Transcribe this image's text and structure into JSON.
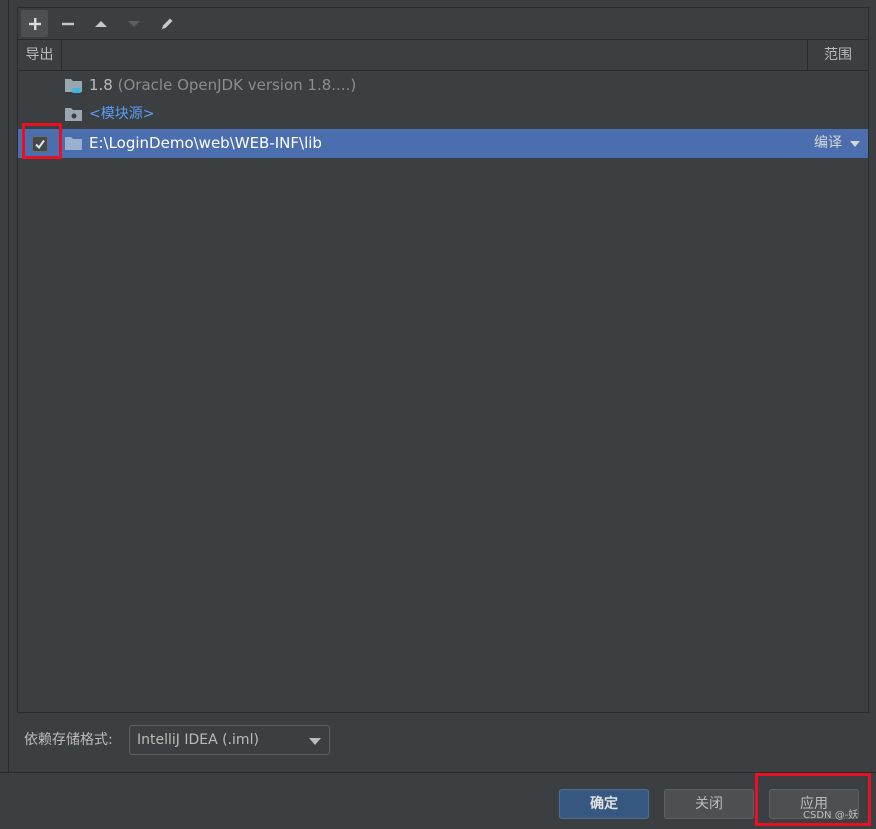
{
  "toolbar": {
    "buttons": [
      {
        "name": "add",
        "icon": "plus-icon",
        "active": true
      },
      {
        "name": "remove",
        "icon": "minus-icon"
      },
      {
        "name": "move-up",
        "icon": "arrow-up-icon"
      },
      {
        "name": "move-down",
        "icon": "arrow-down-icon",
        "disabled": true
      },
      {
        "name": "edit",
        "icon": "pencil-icon"
      }
    ]
  },
  "table": {
    "headers": {
      "export": "导出",
      "scope": "范围"
    },
    "rows": [
      {
        "version": "1.8",
        "detail": "(Oracle OpenJDK version 1.8....)",
        "icon": "jdk-folder-icon"
      },
      {
        "label": "<模块源>",
        "icon": "module-source-folder-icon"
      },
      {
        "path": "E:\\LoginDemo\\web\\WEB-INF\\lib",
        "checked": true,
        "scope": "编译",
        "icon": "folder-icon",
        "selected": true
      }
    ]
  },
  "format": {
    "label": "依赖存储格式:",
    "selected": "IntelliJ IDEA (.iml)"
  },
  "footer": {
    "ok": "确定",
    "close": "关闭",
    "apply": "应用"
  },
  "watermark": "CSDN @-妖",
  "colors": {
    "background": "#3c3f41",
    "selection": "#4b6eaf",
    "highlight": "#e81123",
    "link": "#589df6",
    "default_button": "#365880"
  }
}
